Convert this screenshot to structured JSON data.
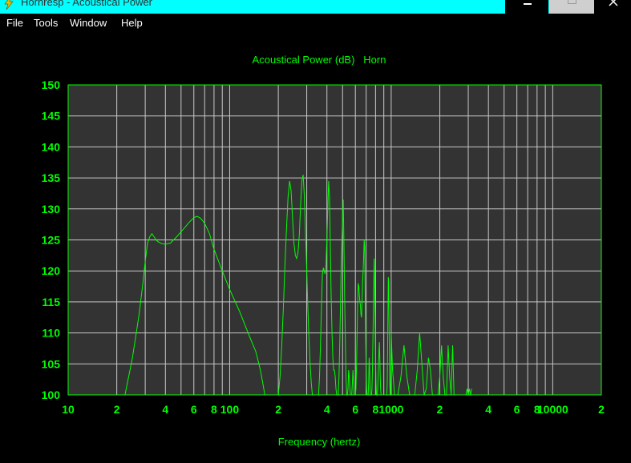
{
  "window": {
    "title": "Hornresp - Acoustical Power"
  },
  "menu": {
    "items": [
      {
        "label": "File",
        "name": "menu-file"
      },
      {
        "label": "Tools",
        "name": "menu-tools"
      },
      {
        "label": "Window",
        "name": "menu-window"
      },
      {
        "label": "Help",
        "name": "menu-help"
      }
    ]
  },
  "colors": {
    "titlebar": "#00ffff",
    "background": "#000000",
    "plot_area": "#333333",
    "grid": "#c8c8c8",
    "axis_text": "#00ff00",
    "trace": "#00ff00"
  },
  "icons": {
    "app": "lightning-icon",
    "minimize": "minimize-icon",
    "maximize": "maximize-icon",
    "close": "close-icon"
  },
  "chart_data": {
    "type": "line",
    "title": "Acoustical Power (dB)   Horn",
    "xlabel": "Frequency (hertz)",
    "ylabel": "",
    "x_scale": "log",
    "xlim": [
      10,
      20000
    ],
    "ylim": [
      100,
      150
    ],
    "grid": true,
    "legend": "none",
    "x_ticks": [
      {
        "v": 10,
        "label": "10"
      },
      {
        "v": 20,
        "label": "2"
      },
      {
        "v": 40,
        "label": "4"
      },
      {
        "v": 60,
        "label": "6"
      },
      {
        "v": 80,
        "label": "8"
      },
      {
        "v": 100,
        "label": "100"
      },
      {
        "v": 200,
        "label": "2"
      },
      {
        "v": 400,
        "label": "4"
      },
      {
        "v": 600,
        "label": "6"
      },
      {
        "v": 800,
        "label": "8"
      },
      {
        "v": 1000,
        "label": "1000"
      },
      {
        "v": 2000,
        "label": "2"
      },
      {
        "v": 4000,
        "label": "4"
      },
      {
        "v": 6000,
        "label": "6"
      },
      {
        "v": 8000,
        "label": "8"
      },
      {
        "v": 10000,
        "label": "10000"
      },
      {
        "v": 20000,
        "label": "2"
      }
    ],
    "y_ticks": [
      100,
      105,
      110,
      115,
      120,
      125,
      130,
      135,
      140,
      145,
      150
    ],
    "series": [
      {
        "x": [
          22.5,
          25,
          27.5,
          29,
          30,
          31,
          32,
          33,
          34,
          35,
          36,
          38,
          40,
          43,
          47,
          52,
          56,
          60,
          63,
          66,
          70,
          75,
          80,
          90,
          100,
          115,
          130,
          145,
          155,
          160,
          165,
          170,
          175,
          180,
          185,
          190,
          195,
          200,
          205,
          210,
          215,
          220,
          225,
          230,
          235,
          240,
          245,
          250,
          255,
          260,
          265,
          270,
          275,
          280,
          285,
          290,
          295,
          300,
          305,
          310,
          315,
          320,
          325,
          330,
          335,
          340,
          345,
          350,
          355,
          360,
          365,
          370,
          375,
          380,
          385,
          390,
          395,
          400,
          405,
          410,
          415,
          420,
          425,
          430,
          435,
          440,
          445,
          450,
          455,
          460,
          465,
          470,
          475,
          480,
          485,
          490,
          495,
          500,
          505,
          510,
          515,
          520,
          525,
          530,
          535,
          540,
          545,
          550,
          555,
          560,
          565,
          570,
          575,
          580,
          585,
          590,
          595,
          600,
          605,
          610,
          615,
          620,
          625,
          630,
          635,
          640,
          645,
          650,
          655,
          660,
          665,
          670,
          675,
          680,
          685,
          690,
          695,
          700,
          705,
          710,
          715,
          720,
          725,
          730,
          735,
          740,
          745,
          750,
          755,
          760,
          765,
          770,
          775,
          780,
          785,
          790,
          795,
          800,
          805,
          810,
          815,
          820,
          825,
          830,
          835,
          840,
          845,
          850,
          855,
          860,
          865,
          870,
          875,
          880,
          885,
          890,
          895,
          900,
          905,
          910,
          915,
          920,
          925,
          930,
          935,
          940,
          945,
          950,
          955,
          960,
          965,
          970,
          975,
          980,
          985,
          990,
          995,
          1000,
          1020,
          1050,
          1100,
          1150,
          1200,
          1250,
          1300,
          1350,
          1400,
          1450,
          1500,
          1550,
          1600,
          1650,
          1700,
          1750,
          1800,
          1850,
          1900,
          1950,
          2000,
          2050,
          2100,
          2150,
          2200,
          2250,
          2300,
          2350,
          2400,
          2450,
          2500,
          2550,
          2600,
          2650,
          2700,
          2750,
          2800,
          2850,
          2900,
          2950,
          3000,
          3050,
          3100,
          3150
        ],
        "y": [
          100,
          106,
          113,
          118,
          121.5,
          124.5,
          125.5,
          126,
          125.5,
          125,
          124.7,
          124.4,
          124.3,
          124.5,
          125.5,
          126.8,
          127.8,
          128.6,
          128.8,
          128.5,
          127.7,
          126,
          123.5,
          120,
          117,
          113.5,
          110,
          107,
          104,
          102,
          100,
          100,
          100,
          100,
          100,
          100,
          100,
          100,
          103,
          108,
          114,
          121,
          127,
          132,
          134.5,
          133,
          128.5,
          124.5,
          122.5,
          122,
          123,
          126,
          131,
          134.5,
          135.5,
          132,
          126,
          120,
          114,
          109,
          105,
          102,
          100,
          100,
          100,
          100,
          100,
          100,
          100,
          103,
          108,
          114,
          119.5,
          120.5,
          120,
          119.5,
          121,
          125,
          130,
          134.5,
          132,
          124,
          116,
          110,
          106,
          104,
          104,
          103,
          101,
          100,
          100,
          100,
          103,
          108,
          114,
          121,
          125,
          128,
          131.5,
          124,
          116,
          109,
          103,
          100,
          100,
          101,
          104,
          103,
          101,
          100,
          100,
          100,
          102,
          104,
          102,
          100,
          100,
          100,
          101,
          105,
          110,
          115,
          118,
          117.5,
          116,
          115,
          114.5,
          113,
          112.5,
          115,
          118,
          120,
          122,
          125,
          124,
          117,
          109,
          104,
          101,
          100,
          100,
          100,
          102,
          106,
          104,
          101,
          100,
          100,
          100,
          101,
          104,
          108,
          113,
          118,
          122,
          118,
          112,
          106,
          102,
          100,
          100,
          100,
          101,
          103,
          105,
          107,
          108.5,
          106,
          103,
          101,
          100,
          100,
          100,
          100,
          100,
          100,
          100,
          100,
          100,
          100,
          100,
          100,
          100,
          100,
          100,
          100,
          102,
          107,
          114,
          119,
          118,
          112,
          106,
          102,
          100,
          100,
          104,
          110,
          104,
          100,
          100,
          103,
          108,
          103,
          100,
          100,
          100,
          104,
          110,
          105,
          100,
          101,
          106,
          104,
          100,
          100,
          100,
          100,
          103,
          108,
          103,
          100,
          100,
          108,
          103,
          100,
          108,
          100,
          100,
          100,
          100,
          100,
          100,
          100,
          100,
          100,
          100,
          101,
          100,
          101,
          100,
          101
        ]
      }
    ]
  }
}
